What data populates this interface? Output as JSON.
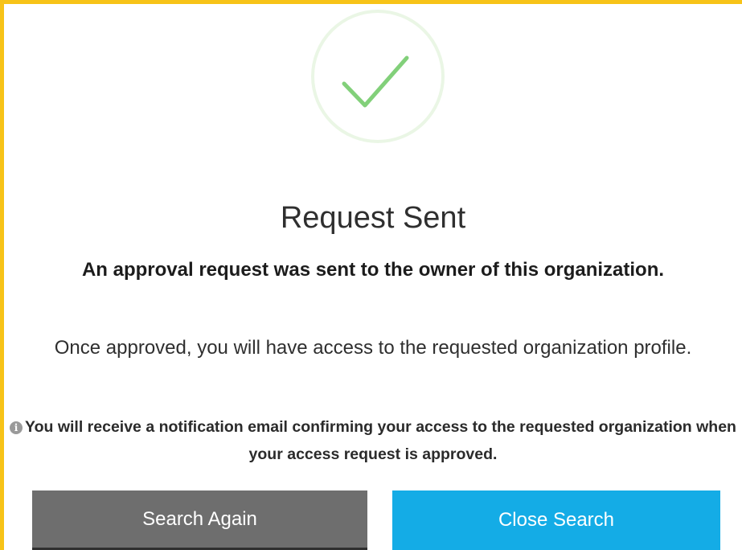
{
  "dialog": {
    "icon": "checkmark-success-icon",
    "title": "Request Sent",
    "lead": "An approval request was sent to the owner of this organization.",
    "info": "Once approved, you will have access to the requested organization profile.",
    "notice_icon": "info-circle-icon",
    "notice_icon_glyph": "i",
    "notice": "You will receive a notification email confirming your access to the requested organization when your access request is approved."
  },
  "buttons": {
    "search_again": "Search Again",
    "close_search": "Close Search"
  },
  "colors": {
    "frame": "#f7c318",
    "check": "#82d07a",
    "secondary_button": "#6e6e6e",
    "primary_button": "#14ace6"
  }
}
